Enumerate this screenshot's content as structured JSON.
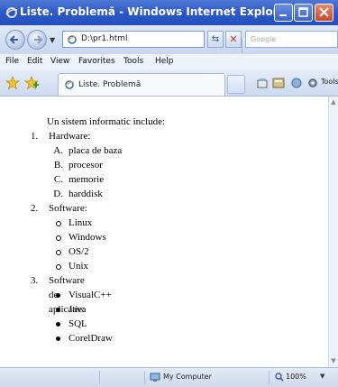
{
  "window": {
    "title": "Liste. Problemă - Windows Internet Explorer"
  },
  "addressbar": {
    "url": "D:\\pr1.html",
    "search_placeholder": "Google"
  },
  "menu": {
    "items": [
      "File",
      "Edit",
      "View",
      "Favorites",
      "Tools",
      "Help"
    ]
  },
  "tab": {
    "label": "Liste. Problemă"
  },
  "toolbar": {
    "tools_label": "Tools"
  },
  "content": {
    "intro": "Un sistem informatic include:",
    "sections": [
      {
        "number": "1.",
        "title": "Hardware:",
        "marker_style": "upper-alpha",
        "items": [
          {
            "mark": "A.",
            "text": "placa de baza"
          },
          {
            "mark": "B.",
            "text": "procesor"
          },
          {
            "mark": "C.",
            "text": "memorie"
          },
          {
            "mark": "D.",
            "text": "harddisk"
          }
        ]
      },
      {
        "number": "2.",
        "title": "Software:",
        "marker_style": "circle",
        "items": [
          {
            "text": "Linux"
          },
          {
            "text": "Windows"
          },
          {
            "text": "OS/2"
          },
          {
            "text": "Unix"
          }
        ]
      },
      {
        "number": "3.",
        "title": "Software de aplicatie:",
        "marker_style": "disc",
        "items": [
          {
            "text": "VisualC++"
          },
          {
            "text": "Java"
          },
          {
            "text": "SQL"
          },
          {
            "text": "CorelDraw"
          }
        ]
      }
    ]
  },
  "statusbar": {
    "zone": "My Computer",
    "zoom": "100%"
  }
}
